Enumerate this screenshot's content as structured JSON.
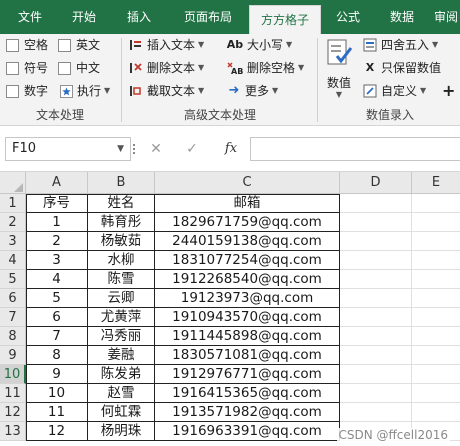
{
  "ribbon_tabs": [
    {
      "label": "文件",
      "active": false
    },
    {
      "label": "开始",
      "active": false
    },
    {
      "label": "插入",
      "active": false
    },
    {
      "label": "页面布局",
      "active": false
    },
    {
      "label": "方方格子",
      "active": true
    },
    {
      "label": "公式",
      "active": false
    },
    {
      "label": "数据",
      "active": false
    },
    {
      "label": "审阅",
      "active": false
    }
  ],
  "ribbon": {
    "text_processing": {
      "checkboxes": [
        "空格",
        "英文",
        "符号",
        "中文",
        "数字"
      ],
      "execute_label": "执行",
      "group_label": "文本处理"
    },
    "advanced_text": {
      "insert_text": "插入文本",
      "delete_text": "删除文本",
      "extract_text": "截取文本",
      "case": "大小写",
      "delete_space": "删除空格",
      "more": "更多",
      "group_label": "高级文本处理"
    },
    "number_entry": {
      "value_label": "数值",
      "round": "四舍五入",
      "keep_value": "只保留数值",
      "custom": "自定义",
      "plus": "+",
      "group_label": "数值录入"
    }
  },
  "formula_bar": {
    "name_box": "F10",
    "cancel_symbol": "✕",
    "confirm_symbol": "✓",
    "fx_label": "fx",
    "formula": ""
  },
  "sheet": {
    "columns": [
      "A",
      "B",
      "C",
      "D",
      "E"
    ],
    "active_row": 10,
    "header": {
      "a": "序号",
      "b": "姓名",
      "c": "邮箱"
    },
    "rows": [
      {
        "n": "2",
        "a": "1",
        "b": "韩育彤",
        "c": "1829671759@qq.com"
      },
      {
        "n": "3",
        "a": "2",
        "b": "杨敏茹",
        "c": "2440159138@qq.com"
      },
      {
        "n": "4",
        "a": "3",
        "b": "水柳",
        "c": "1831077254@qq.com"
      },
      {
        "n": "5",
        "a": "4",
        "b": "陈雪",
        "c": "1912268540@qq.com"
      },
      {
        "n": "6",
        "a": "5",
        "b": "云卿",
        "c": "19123973@qq.com"
      },
      {
        "n": "7",
        "a": "6",
        "b": "尤黄萍",
        "c": "1910943570@qq.com"
      },
      {
        "n": "8",
        "a": "7",
        "b": "冯秀丽",
        "c": "1911445898@qq.com"
      },
      {
        "n": "9",
        "a": "8",
        "b": "姜融",
        "c": "1830571081@qq.com"
      },
      {
        "n": "10",
        "a": "9",
        "b": "陈发弟",
        "c": "1912976771@qq.com"
      },
      {
        "n": "11",
        "a": "10",
        "b": "赵雪",
        "c": "1916415365@qq.com"
      },
      {
        "n": "12",
        "a": "11",
        "b": "何虹霖",
        "c": "1913571982@qq.com"
      },
      {
        "n": "13",
        "a": "12",
        "b": "杨明珠",
        "c": "1916963391@qq.com"
      }
    ]
  },
  "watermark": "CSDN @ffcell2016",
  "colors": {
    "accent": "#217346",
    "ribbon_bg": "#f3f3f3",
    "header_bg": "#e9e9e9"
  }
}
